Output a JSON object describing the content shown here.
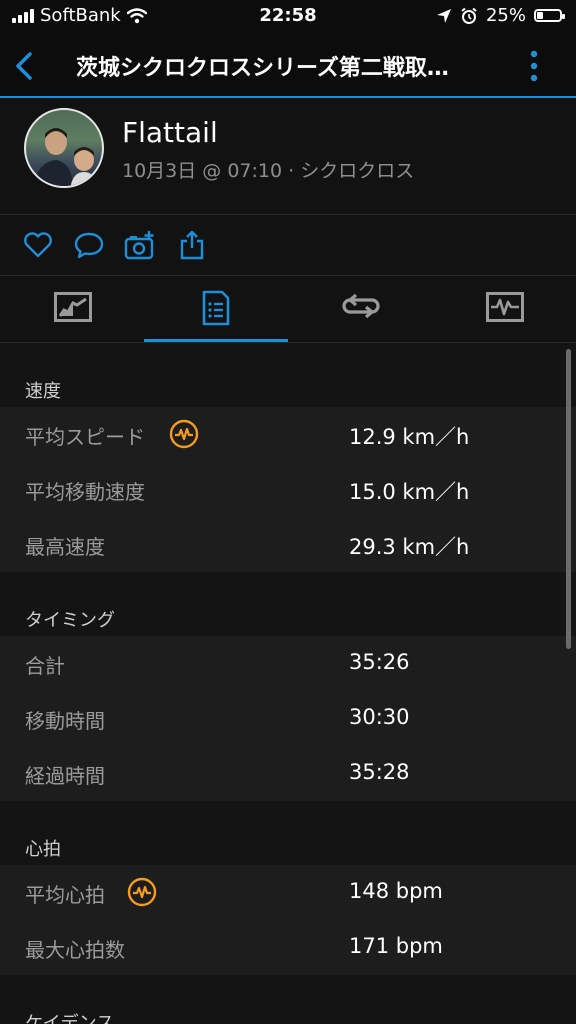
{
  "status_bar": {
    "carrier": "SoftBank",
    "time": "22:58",
    "battery": "25%",
    "battery_level": 0.25
  },
  "nav": {
    "title": "茨城シクロクロスシリーズ第二戦取…"
  },
  "profile": {
    "name": "Flattail",
    "meta": "10月3日 @ 07:10 · シクロクロス"
  },
  "actions": [
    "like-icon",
    "comment-icon",
    "add-photo-icon",
    "share-icon"
  ],
  "tabs": [
    "chart-tab-icon",
    "stats-list-tab-icon",
    "laps-tab-icon",
    "monitor-tab-icon"
  ],
  "colors": {
    "accent": "#1c8fd8",
    "badge": "#f39c1f",
    "background": "#121212",
    "row": "#1d1d1d",
    "label": "#9b9b9b"
  },
  "sections": {
    "speed": {
      "title": "速度",
      "rows": [
        {
          "label": "平均スピード",
          "value": "12.9 km／h"
        },
        {
          "label": "平均移動速度",
          "value": "15.0 km／h"
        },
        {
          "label": "最高速度",
          "value": "29.3 km／h"
        }
      ]
    },
    "timing": {
      "title": "タイミング",
      "rows": [
        {
          "label": "合計",
          "value": "35:26"
        },
        {
          "label": "移動時間",
          "value": "30:30"
        },
        {
          "label": "経過時間",
          "value": "35:28"
        }
      ]
    },
    "heart": {
      "title": "心拍",
      "rows": [
        {
          "label": "平均心拍",
          "value": "148 bpm"
        },
        {
          "label": "最大心拍数",
          "value": "171 bpm"
        }
      ]
    },
    "cadence": {
      "title": "ケイデンス"
    }
  }
}
